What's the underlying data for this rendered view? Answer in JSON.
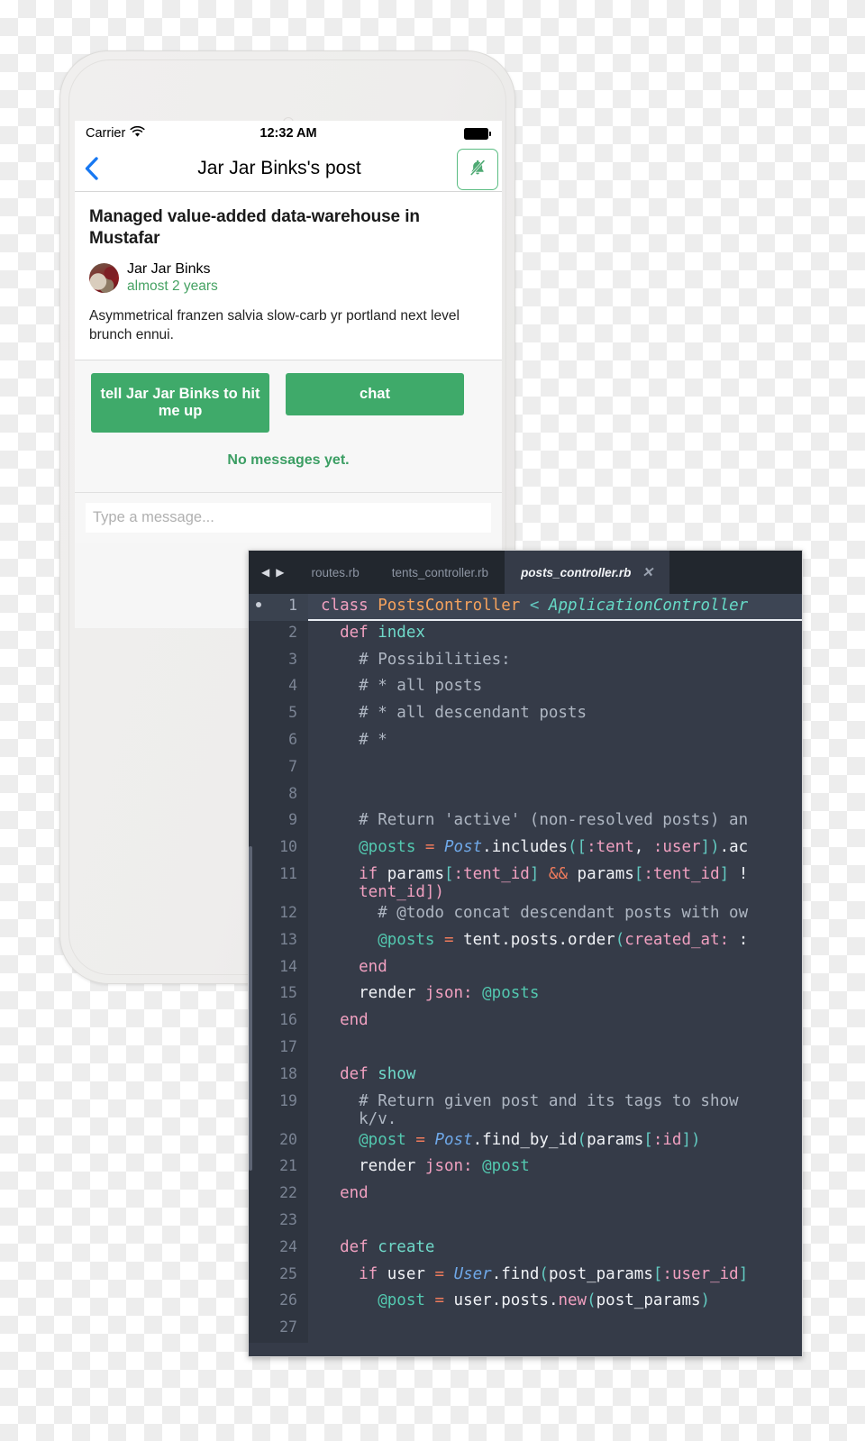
{
  "phone": {
    "status_bar": {
      "carrier": "Carrier",
      "wifi_icon": "wifi-icon",
      "time": "12:32 AM",
      "battery_icon": "battery-full-icon"
    },
    "nav_bar": {
      "back_icon": "chevron-left-icon",
      "title": "Jar Jar Binks's post",
      "mute_icon": "bell-slash-icon"
    },
    "post": {
      "title": "Managed value-added data-warehouse in Mustafar",
      "author": "Jar Jar Binks",
      "timestamp": "almost 2 years",
      "avatar_icon": "avatar-cat-image",
      "body": "Asymmetrical franzen salvia slow-carb yr portland next level brunch ennui."
    },
    "actions": {
      "tell_label": "tell Jar Jar Binks to hit me up",
      "chat_label": "chat",
      "empty_state": "No messages yet."
    },
    "composer": {
      "placeholder": "Type a message...",
      "value": ""
    },
    "colors": {
      "accent_green": "#3faa6a",
      "link_green": "#46a263",
      "ios_blue": "#1778f2"
    }
  },
  "editor": {
    "nav_prev_icon": "triangle-left-icon",
    "nav_next_icon": "triangle-right-icon",
    "tabs": [
      {
        "label": "routes.rb",
        "active": false
      },
      {
        "label": "tents_controller.rb",
        "active": false
      },
      {
        "label": "posts_controller.rb",
        "active": true,
        "close_icon": "close-icon"
      }
    ],
    "colors": {
      "background": "#353b48",
      "gutter": "#2f3540",
      "tab_bar": "#22272e",
      "keyword": "#f0a0c0",
      "class_name": "#f5a25d",
      "superclass": "#66d9c6",
      "constant": "#6fa8e8",
      "comment": "#aeb6c2",
      "ivar": "#53c9b0",
      "operator": "#ef7b5c",
      "symbol": "#f0a0c0",
      "punctuation": "#62c9c0"
    },
    "lines": [
      {
        "num": "1",
        "active": true,
        "marker": true,
        "indent": 0,
        "tokens": [
          [
            "kw",
            "class"
          ],
          [
            "wht",
            " "
          ],
          [
            "cls",
            "PostsController"
          ],
          [
            "wht",
            " "
          ],
          [
            "punc",
            "<"
          ],
          [
            "wht",
            " "
          ],
          [
            "sup",
            "ApplicationController"
          ]
        ]
      },
      {
        "num": "2",
        "active": false,
        "marker": false,
        "indent": 1,
        "tokens": [
          [
            "kw",
            "def"
          ],
          [
            "wht",
            " "
          ],
          [
            "mth-def",
            "index"
          ]
        ]
      },
      {
        "num": "3",
        "active": false,
        "marker": false,
        "indent": 2,
        "tokens": [
          [
            "cmt",
            "# Possibilities:"
          ]
        ]
      },
      {
        "num": "4",
        "active": false,
        "marker": false,
        "indent": 2,
        "tokens": [
          [
            "cmt",
            "# * all posts"
          ]
        ]
      },
      {
        "num": "5",
        "active": false,
        "marker": false,
        "indent": 2,
        "tokens": [
          [
            "cmt",
            "# * all descendant posts"
          ]
        ]
      },
      {
        "num": "6",
        "active": false,
        "marker": false,
        "indent": 2,
        "tokens": [
          [
            "cmt",
            "# *"
          ]
        ]
      },
      {
        "num": "7",
        "active": false,
        "marker": false,
        "indent": 0,
        "tokens": []
      },
      {
        "num": "8",
        "active": false,
        "marker": false,
        "indent": 0,
        "tokens": []
      },
      {
        "num": "9",
        "active": false,
        "marker": false,
        "indent": 2,
        "tokens": [
          [
            "cmt",
            "# Return 'active' (non-resolved posts) an"
          ]
        ]
      },
      {
        "num": "10",
        "active": false,
        "marker": false,
        "indent": 2,
        "tokens": [
          [
            "ivar",
            "@posts"
          ],
          [
            "wht",
            " "
          ],
          [
            "op",
            "="
          ],
          [
            "wht",
            " "
          ],
          [
            "const",
            "Post"
          ],
          [
            "wht",
            "."
          ],
          [
            "meth",
            "includes"
          ],
          [
            "punc",
            "(["
          ],
          [
            "sym",
            ":tent"
          ],
          [
            "wht",
            ", "
          ],
          [
            "sym",
            ":user"
          ],
          [
            "punc",
            "])"
          ],
          [
            "wht",
            ".ac"
          ]
        ]
      },
      {
        "num": "11",
        "active": false,
        "marker": false,
        "indent": 2,
        "wrap": "tent_id])",
        "wrap_indent": 2,
        "tokens": [
          [
            "kw",
            "if"
          ],
          [
            "wht",
            " "
          ],
          [
            "meth",
            "params"
          ],
          [
            "punc",
            "["
          ],
          [
            "sym",
            ":tent_id"
          ],
          [
            "punc",
            "]"
          ],
          [
            "wht",
            " "
          ],
          [
            "op",
            "&&"
          ],
          [
            "wht",
            " "
          ],
          [
            "meth",
            "params"
          ],
          [
            "punc",
            "["
          ],
          [
            "sym",
            ":tent_id"
          ],
          [
            "punc",
            "]"
          ],
          [
            "wht",
            " !"
          ]
        ]
      },
      {
        "num": "12",
        "active": false,
        "marker": false,
        "indent": 3,
        "tokens": [
          [
            "cmt",
            "# @todo concat descendant posts with ow"
          ]
        ]
      },
      {
        "num": "13",
        "active": false,
        "marker": false,
        "indent": 3,
        "tokens": [
          [
            "ivar",
            "@posts"
          ],
          [
            "wht",
            " "
          ],
          [
            "op",
            "="
          ],
          [
            "wht",
            " "
          ],
          [
            "meth",
            "tent"
          ],
          [
            "wht",
            "."
          ],
          [
            "meth",
            "posts"
          ],
          [
            "wht",
            "."
          ],
          [
            "meth",
            "order"
          ],
          [
            "punc",
            "("
          ],
          [
            "sym",
            "created_at:"
          ],
          [
            "wht",
            " :"
          ]
        ]
      },
      {
        "num": "14",
        "active": false,
        "marker": false,
        "indent": 2,
        "tokens": [
          [
            "kw",
            "end"
          ]
        ]
      },
      {
        "num": "15",
        "active": false,
        "marker": false,
        "indent": 2,
        "tokens": [
          [
            "meth",
            "render"
          ],
          [
            "wht",
            " "
          ],
          [
            "sym",
            "json:"
          ],
          [
            "wht",
            " "
          ],
          [
            "ivar",
            "@posts"
          ]
        ]
      },
      {
        "num": "16",
        "active": false,
        "marker": false,
        "indent": 1,
        "tokens": [
          [
            "kw",
            "end"
          ]
        ]
      },
      {
        "num": "17",
        "active": false,
        "marker": false,
        "indent": 0,
        "tokens": []
      },
      {
        "num": "18",
        "active": false,
        "marker": false,
        "indent": 1,
        "tokens": [
          [
            "kw",
            "def"
          ],
          [
            "wht",
            " "
          ],
          [
            "mth-def",
            "show"
          ]
        ]
      },
      {
        "num": "19",
        "active": false,
        "marker": false,
        "indent": 2,
        "wrap": "k/v.",
        "wrap_indent": 2,
        "wrap_class": "cmt",
        "tokens": [
          [
            "cmt",
            "# Return given post and its tags to show"
          ]
        ]
      },
      {
        "num": "20",
        "active": false,
        "marker": false,
        "indent": 2,
        "tokens": [
          [
            "ivar",
            "@post"
          ],
          [
            "wht",
            " "
          ],
          [
            "op",
            "="
          ],
          [
            "wht",
            " "
          ],
          [
            "const",
            "Post"
          ],
          [
            "wht",
            "."
          ],
          [
            "meth",
            "find_by_id"
          ],
          [
            "punc",
            "("
          ],
          [
            "meth",
            "params"
          ],
          [
            "punc",
            "["
          ],
          [
            "sym",
            ":id"
          ],
          [
            "punc",
            "])"
          ]
        ]
      },
      {
        "num": "21",
        "active": false,
        "marker": false,
        "indent": 2,
        "tokens": [
          [
            "meth",
            "render"
          ],
          [
            "wht",
            " "
          ],
          [
            "sym",
            "json:"
          ],
          [
            "wht",
            " "
          ],
          [
            "ivar",
            "@post"
          ]
        ]
      },
      {
        "num": "22",
        "active": false,
        "marker": false,
        "indent": 1,
        "tokens": [
          [
            "kw",
            "end"
          ]
        ]
      },
      {
        "num": "23",
        "active": false,
        "marker": false,
        "indent": 0,
        "tokens": []
      },
      {
        "num": "24",
        "active": false,
        "marker": false,
        "indent": 1,
        "tokens": [
          [
            "kw",
            "def"
          ],
          [
            "wht",
            " "
          ],
          [
            "mth-def",
            "create"
          ]
        ]
      },
      {
        "num": "25",
        "active": false,
        "marker": false,
        "indent": 2,
        "tokens": [
          [
            "kw",
            "if"
          ],
          [
            "wht",
            " "
          ],
          [
            "meth",
            "user"
          ],
          [
            "wht",
            " "
          ],
          [
            "op",
            "="
          ],
          [
            "wht",
            " "
          ],
          [
            "const",
            "User"
          ],
          [
            "wht",
            "."
          ],
          [
            "meth",
            "find"
          ],
          [
            "punc",
            "("
          ],
          [
            "meth",
            "post_params"
          ],
          [
            "punc",
            "["
          ],
          [
            "sym",
            ":user_id"
          ],
          [
            "punc",
            "]"
          ]
        ]
      },
      {
        "num": "26",
        "active": false,
        "marker": false,
        "indent": 3,
        "tokens": [
          [
            "ivar",
            "@post"
          ],
          [
            "wht",
            " "
          ],
          [
            "op",
            "="
          ],
          [
            "wht",
            " "
          ],
          [
            "meth",
            "user"
          ],
          [
            "wht",
            "."
          ],
          [
            "meth",
            "posts"
          ],
          [
            "wht",
            "."
          ],
          [
            "kw",
            "new"
          ],
          [
            "punc",
            "("
          ],
          [
            "meth",
            "post_params"
          ],
          [
            "punc",
            ")"
          ]
        ]
      },
      {
        "num": "27",
        "active": false,
        "marker": false,
        "indent": 3,
        "tokens": [
          [
            "wht",
            "  "
          ]
        ]
      }
    ]
  }
}
